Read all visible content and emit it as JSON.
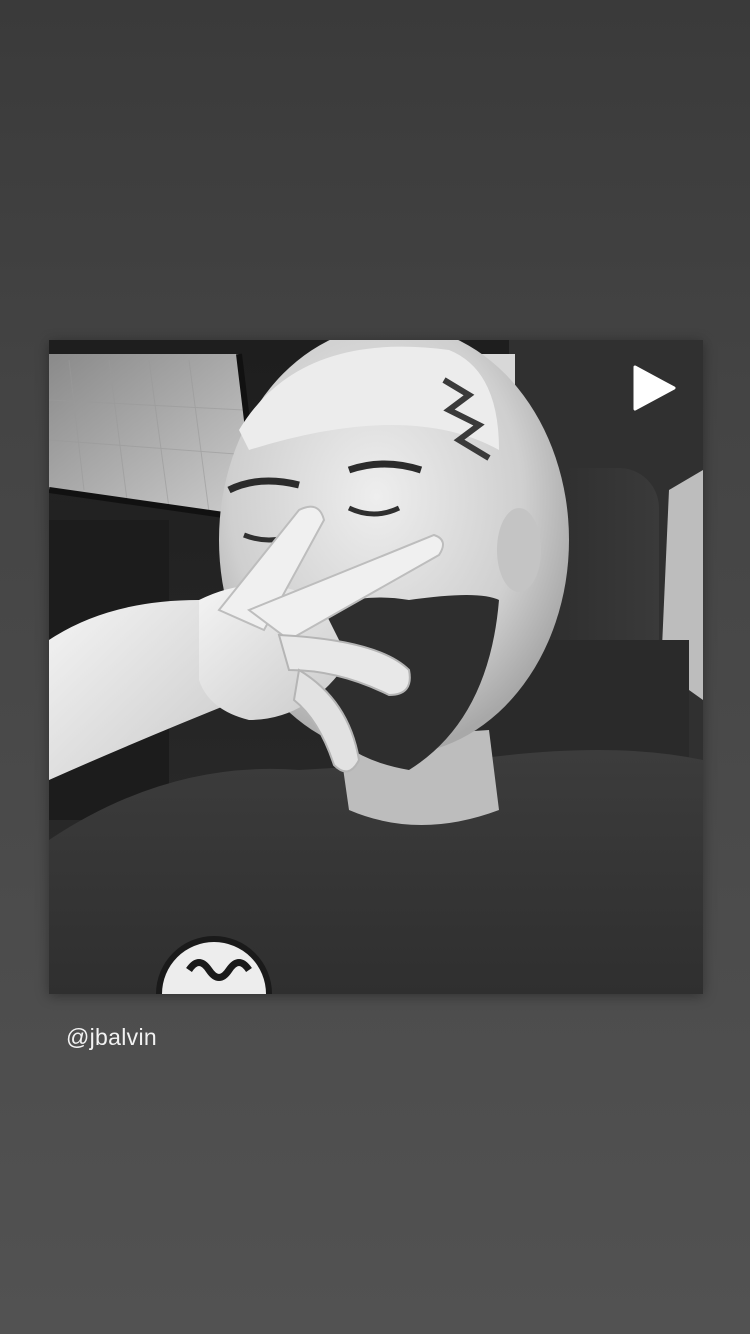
{
  "story": {
    "post": {
      "media_type": "video",
      "indicator_icon": "play-icon",
      "photo_tone": "black-and-white"
    },
    "mention": "@jbalvin"
  },
  "colors": {
    "background_top": "#3a3a3a",
    "background_bottom": "#525252",
    "text": "#f2f2f2"
  }
}
